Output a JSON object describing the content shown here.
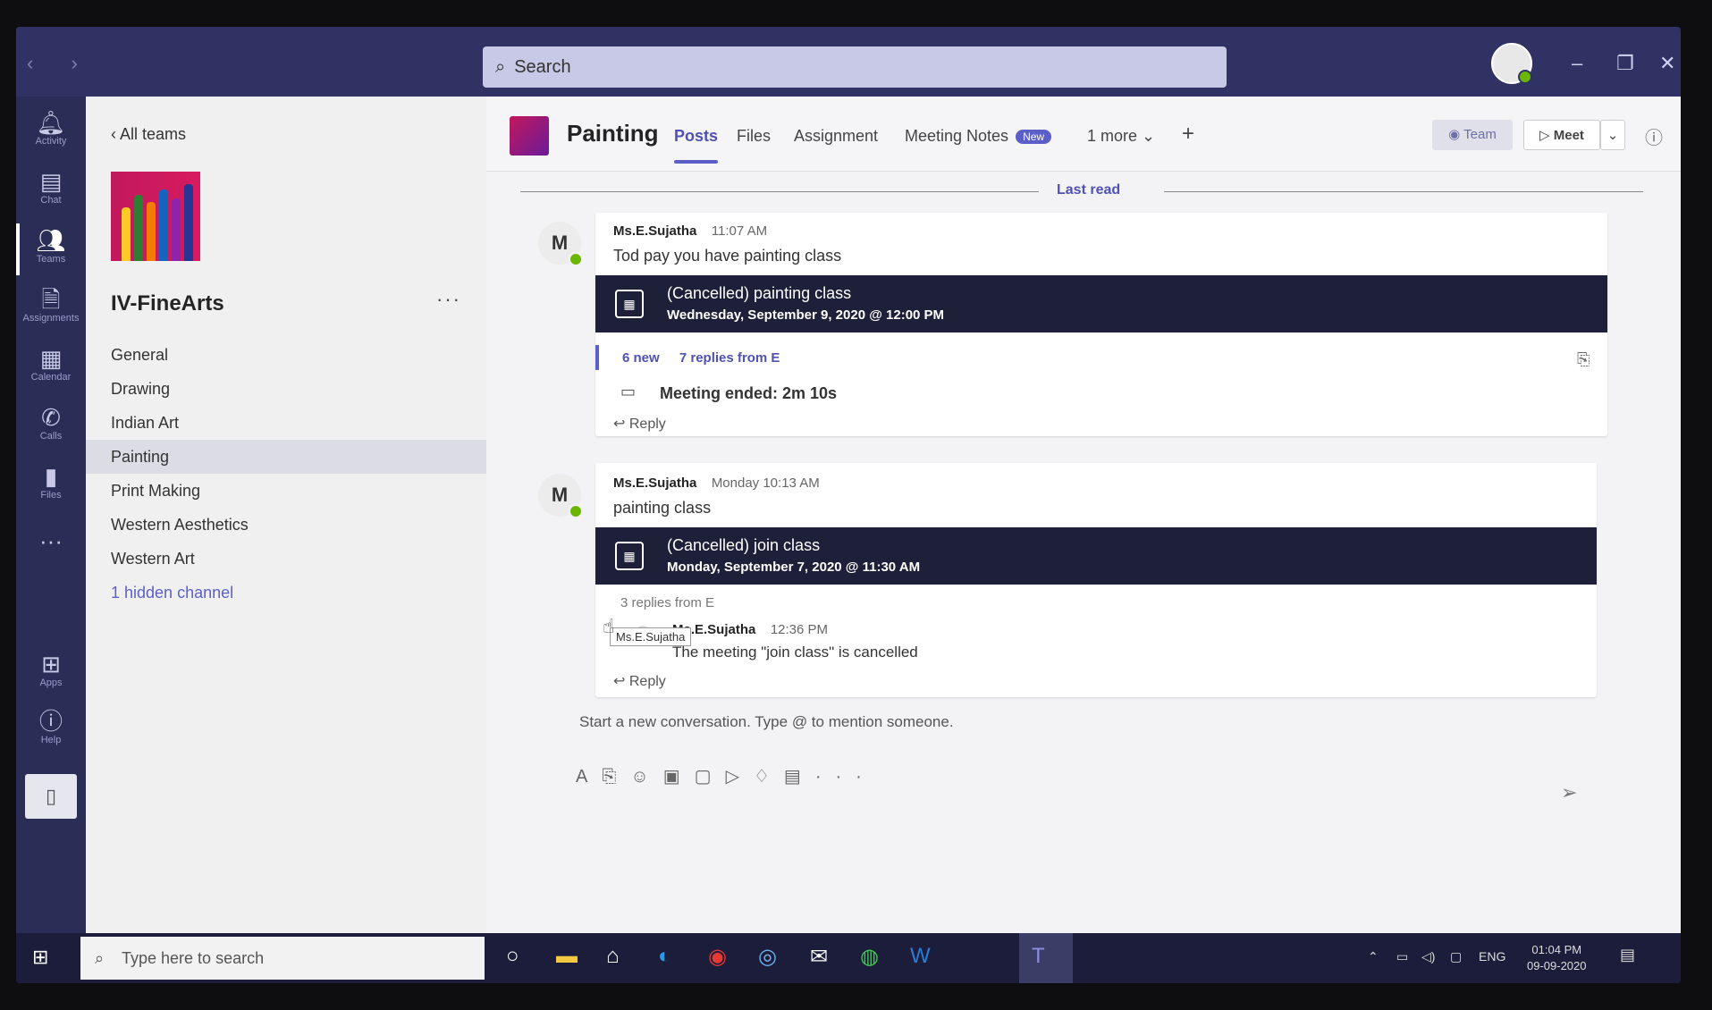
{
  "search": {
    "placeholder": "Search"
  },
  "rail": {
    "items": [
      {
        "label": "Activity",
        "icon": "bell-icon"
      },
      {
        "label": "Chat",
        "icon": "chat-icon"
      },
      {
        "label": "Teams",
        "icon": "teams-icon"
      },
      {
        "label": "Assignments",
        "icon": "assignments-icon"
      },
      {
        "label": "Calendar",
        "icon": "calendar-icon"
      },
      {
        "label": "Calls",
        "icon": "phone-icon"
      },
      {
        "label": "Files",
        "icon": "file-icon"
      },
      {
        "label": "Apps",
        "icon": "apps-icon"
      },
      {
        "label": "Help",
        "icon": "help-icon"
      }
    ]
  },
  "teams_panel": {
    "back_label": "All teams",
    "team_name": "IV-FineArts",
    "channels": [
      "General",
      "Drawing",
      "Indian Art",
      "Painting",
      "Print Making",
      "Western Aesthetics",
      "Western Art"
    ],
    "active_channel": "Painting",
    "hidden_channels": "1 hidden channel"
  },
  "header": {
    "title": "Painting",
    "tabs": [
      "Posts",
      "Files",
      "Assignment",
      "Meeting Notes"
    ],
    "new_badge": "New",
    "more": "1 more",
    "team_btn": "Team",
    "meet_btn": "Meet"
  },
  "feed": {
    "last_read": "Last read",
    "posts": [
      {
        "avatar": "M",
        "author": "Ms.E.Sujatha",
        "time": "11:07 AM",
        "text": "Tod pay you have painting class",
        "meeting_title": "(Cancelled) painting class",
        "meeting_when": "Wednesday, September 9, 2020 @ 12:00 PM",
        "new_count": "6 new",
        "replies": "7 replies from E",
        "meeting_ended": "Meeting ended: 2m 10s",
        "reply": "Reply"
      },
      {
        "avatar": "M",
        "author": "Ms.E.Sujatha",
        "time": "Monday 10:13 AM",
        "text": "painting class",
        "meeting_title": "(Cancelled) join class",
        "meeting_when": "Monday, September 7, 2020 @ 11:30 AM",
        "replies": "3 replies from E",
        "sub_author": "Ms.E.Sujatha",
        "sub_time": "12:36 PM",
        "sub_text": "The meeting \"join class\" is cancelled",
        "reply": "Reply"
      }
    ],
    "tooltip": "Ms.E.Sujatha",
    "compose_placeholder": "Start a new conversation. Type @ to mention someone."
  },
  "taskbar": {
    "search_placeholder": "Type here to search",
    "lang": "ENG",
    "time": "01:04 PM",
    "date": "09-09-2020"
  }
}
